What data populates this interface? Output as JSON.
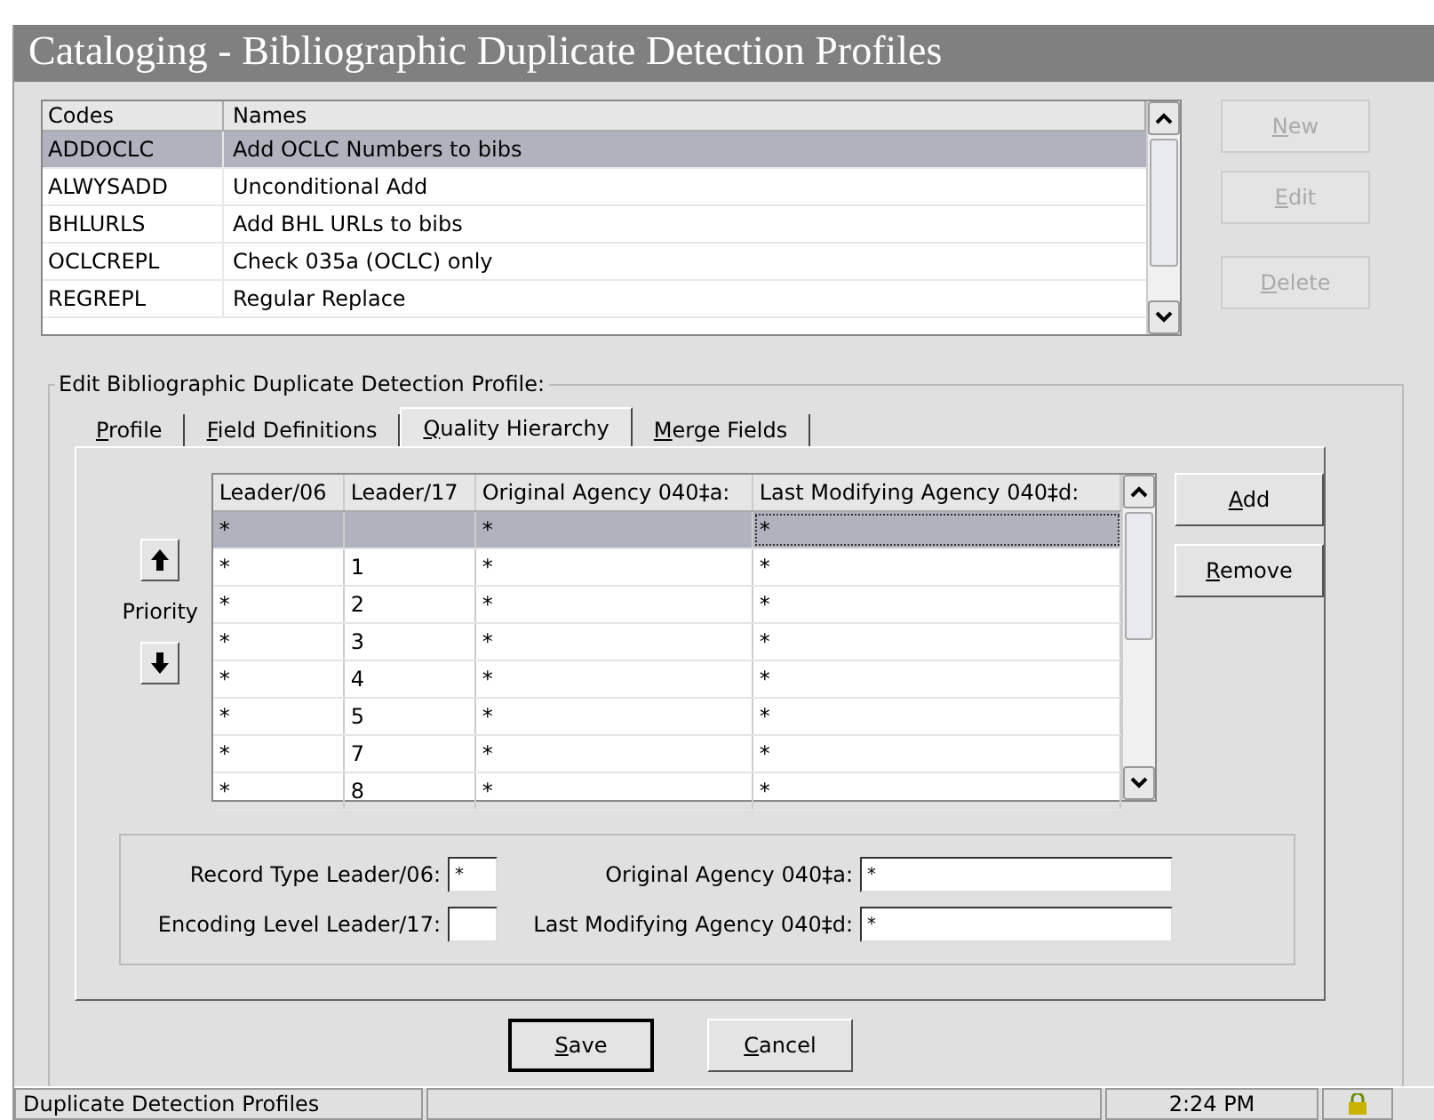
{
  "window": {
    "title": "Cataloging - Bibliographic Duplicate Detection Profiles"
  },
  "profiles": {
    "columns": [
      "Codes",
      "Names"
    ],
    "rows": [
      {
        "code": "ADDOCLC",
        "name": "Add OCLC Numbers to bibs",
        "selected": true
      },
      {
        "code": "ALWYSADD",
        "name": "Unconditional Add",
        "selected": false
      },
      {
        "code": "BHLURLS",
        "name": "Add BHL URLs to bibs",
        "selected": false
      },
      {
        "code": "OCLCREPL",
        "name": "Check 035a (OCLC) only",
        "selected": false
      },
      {
        "code": "REGREPL",
        "name": "Regular Replace",
        "selected": false
      }
    ]
  },
  "side_buttons": [
    {
      "label": "New",
      "disabled": true
    },
    {
      "label": "Edit",
      "disabled": true
    },
    {
      "label": "Delete",
      "disabled": true
    }
  ],
  "group_title": "Edit  Bibliographic Duplicate Detection Profile:",
  "tabs": [
    {
      "label": "Profile",
      "selected": false
    },
    {
      "label": "Field Definitions",
      "selected": false
    },
    {
      "label": "Quality Hierarchy",
      "selected": true
    },
    {
      "label": "Merge Fields",
      "selected": false
    }
  ],
  "priority_label": "Priority",
  "grid": {
    "columns": [
      "Leader/06",
      "Leader/17",
      "Original Agency 040‡a:",
      "Last Modifying Agency 040‡d:"
    ],
    "rows": [
      {
        "cells": [
          "*",
          null,
          "*",
          "*"
        ],
        "selected": true
      },
      {
        "cells": [
          "*",
          "1",
          "*",
          "*"
        ],
        "selected": false
      },
      {
        "cells": [
          "*",
          "2",
          "*",
          "*"
        ],
        "selected": false
      },
      {
        "cells": [
          "*",
          "3",
          "*",
          "*"
        ],
        "selected": false
      },
      {
        "cells": [
          "*",
          "4",
          "*",
          "*"
        ],
        "selected": false
      },
      {
        "cells": [
          "*",
          "5",
          "*",
          "*"
        ],
        "selected": false
      },
      {
        "cells": [
          "*",
          "7",
          "*",
          "*"
        ],
        "selected": false
      },
      {
        "cells": [
          "*",
          "8",
          "*",
          "*"
        ],
        "selected": false
      }
    ]
  },
  "grid_buttons": [
    "Add",
    "Remove"
  ],
  "fields": [
    {
      "label": "Record Type Leader/06:",
      "value": "*"
    },
    {
      "label": "Original Agency 040‡a:",
      "value": "*"
    },
    {
      "label": "Encoding Level Leader/17:"
    },
    {
      "label": "Last Modifying Agency 040‡d:",
      "value": "*"
    }
  ],
  "buttons": [
    {
      "label": "Save",
      "default": true
    },
    {
      "label": "Cancel",
      "default": false
    }
  ],
  "status_bar": {
    "text": "Duplicate Detection Profiles",
    "time": "2:24 PM"
  }
}
